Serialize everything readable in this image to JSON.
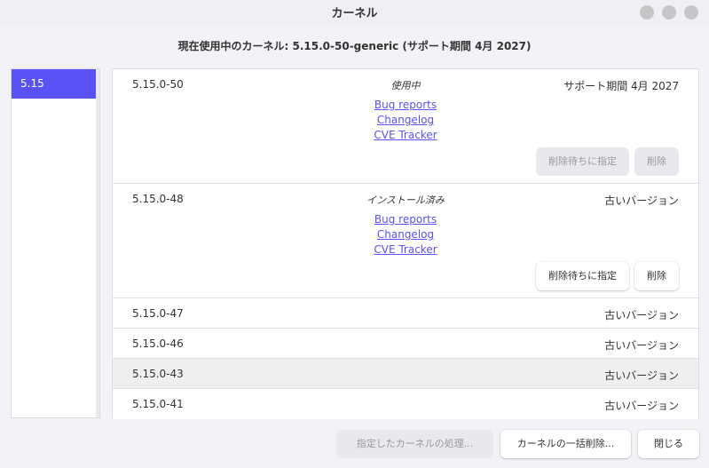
{
  "window": {
    "title": "カーネル",
    "controls": [
      "minimize",
      "maximize",
      "close"
    ]
  },
  "current_kernel_text": "現在使用中のカーネル: 5.15.0-50-generic (サポート期間 4月 2027)",
  "sidebar": {
    "items": [
      {
        "label": "5.15",
        "selected": true
      }
    ]
  },
  "kernels": [
    {
      "version": "5.15.0-50",
      "status": "使用中",
      "support": "サポート期間 4月 2027",
      "links": [
        "Bug reports",
        "Changelog",
        "CVE Tracker"
      ],
      "queue_label": "削除待ちに指定",
      "remove_label": "削除",
      "buttons_enabled": false
    },
    {
      "version": "5.15.0-48",
      "status": "インストール済み",
      "support": "古いバージョン",
      "links": [
        "Bug reports",
        "Changelog",
        "CVE Tracker"
      ],
      "queue_label": "削除待ちに指定",
      "remove_label": "削除",
      "buttons_enabled": true
    },
    {
      "version": "5.15.0-47",
      "support": "古いバージョン"
    },
    {
      "version": "5.15.0-46",
      "support": "古いバージョン"
    },
    {
      "version": "5.15.0-43",
      "support": "古いバージョン",
      "highlighted": true
    },
    {
      "version": "5.15.0-41",
      "support": "古いバージョン"
    }
  ],
  "footer": {
    "perform_label": "指定したカーネルの処理...",
    "bulk_remove_label": "カーネルの一括削除...",
    "close_label": "閉じる"
  },
  "colors": {
    "accent": "#5a52f5",
    "background": "#f2f2f7",
    "link": "#5a52f5"
  }
}
